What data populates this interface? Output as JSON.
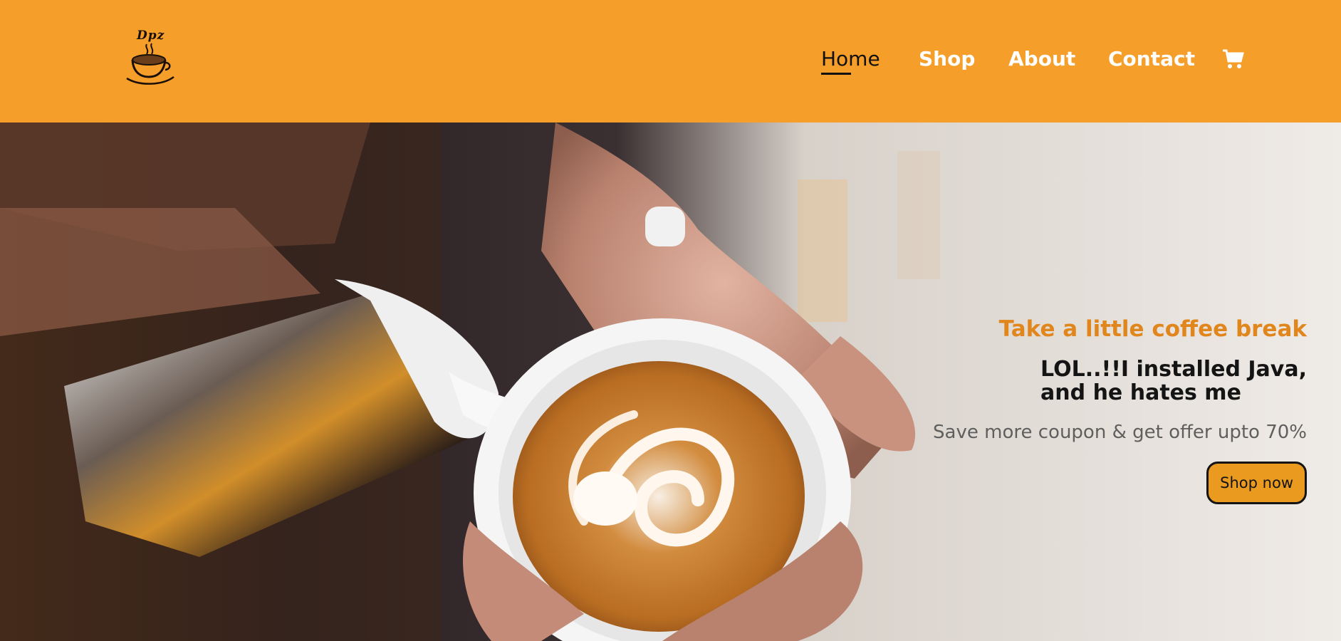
{
  "navbar": {
    "logo_text": "Dpz",
    "links": [
      {
        "label": "Home",
        "active": true
      },
      {
        "label": "Shop",
        "active": false
      },
      {
        "label": "About",
        "active": false
      },
      {
        "label": "Contact",
        "active": false
      }
    ],
    "cart_icon": "shopping-cart-icon",
    "background_color": "#f59e2a"
  },
  "hero": {
    "image_icon": "latte-art-photo",
    "tagline": "Take a little coffee break",
    "headline_line1": "LOL..!!I installed Java,",
    "headline_line2": "and he hates me",
    "subtitle": "Save more coupon & get offer upto 70%",
    "cta_label": "Shop now",
    "accent_color": "#e0861d",
    "button_color": "#e99a1f"
  }
}
